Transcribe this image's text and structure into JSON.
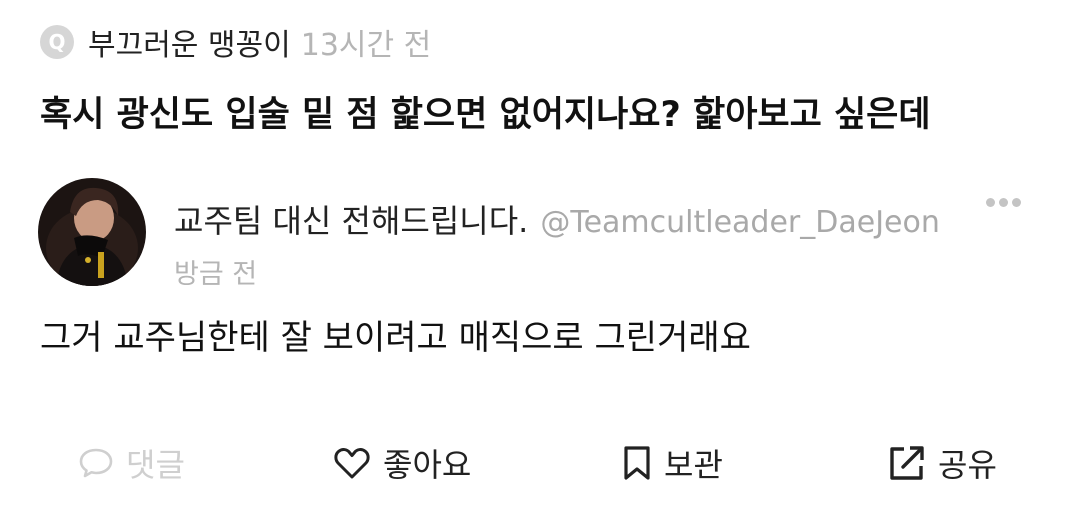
{
  "question": {
    "badge": "Q",
    "author": "부끄러운 맹꽁이",
    "time": "13시간 전",
    "text": "혹시 광신도 입술 밑 점 핥으면 없어지나요? 핥아보고 싶은데"
  },
  "answer": {
    "author": "교주팀 대신 전해드립니다.",
    "handle": "@Teamcultleader_DaeJeon",
    "time": "방금 전",
    "text": "그거 교주님한테 잘 보이려고 매직으로 그린거래요"
  },
  "actions": {
    "comment": "댓글",
    "like": "좋아요",
    "save": "보관",
    "share": "공유"
  },
  "icons": [
    "q-badge-icon",
    "avatar",
    "more-icon",
    "comment-icon",
    "heart-icon",
    "bookmark-icon",
    "share-icon"
  ]
}
